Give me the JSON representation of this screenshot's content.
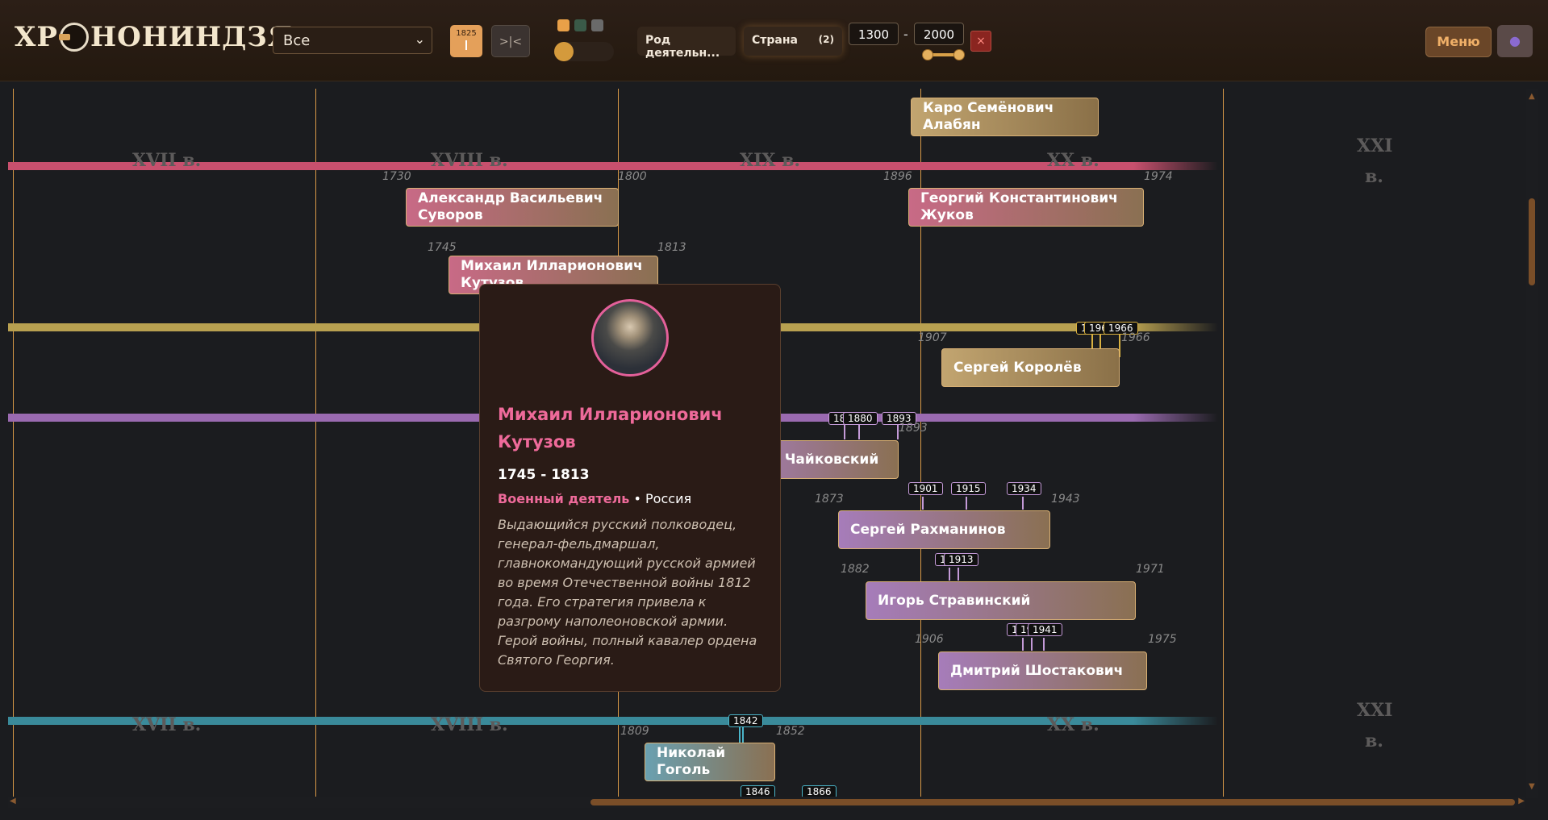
{
  "header": {
    "logo_text_before": "ХР",
    "logo_text_after": "НОНИНДЗЯ",
    "category_select": "Все",
    "year_button_value": "1825",
    "compare_button_label": ">|<",
    "filter_activity": "Род деятельн...",
    "filter_country": "Страна",
    "filter_country_count": "(2)",
    "year_from": "1300",
    "year_to": "2000",
    "range_separator": "-",
    "clear_label": "×",
    "menu_label": "Меню",
    "theme_colors": [
      "#e8a048",
      "#3a5a48",
      "#6a6a6a"
    ]
  },
  "centuries": {
    "c17": "XVII в.",
    "c18": "XVIII в.",
    "c19": "XIX в.",
    "c20": "XX в.",
    "c21a": "XXI",
    "c21b": "в."
  },
  "persons": {
    "alabyan": {
      "name": "Каро Семёнович Алабян"
    },
    "suvorov": {
      "name": "Александр Васильевич Суворов",
      "born": "1730",
      "died": "1800"
    },
    "zhukov": {
      "name": "Георгий Константинович Жуков",
      "born": "1896",
      "died": "1974"
    },
    "kutuzov": {
      "name": "Михаил Илларионович Кутузов",
      "born": "1745",
      "died": "1813"
    },
    "korolev": {
      "name": "Сергей Королёв",
      "born": "1907",
      "died": "1966"
    },
    "tchaikovsky": {
      "name": "Пётр Чайковский",
      "died": "1893"
    },
    "rachmaninov": {
      "name": "Сергей Рахманинов",
      "born": "1873",
      "died": "1943"
    },
    "stravinsky": {
      "name": "Игорь Стравинский",
      "born": "1882",
      "died": "1971"
    },
    "shostakovich": {
      "name": "Дмитрий Шостакович",
      "born": "1906",
      "died": "1975"
    },
    "gogol": {
      "name": "Николай Гоголь",
      "born": "1809",
      "died": "1852"
    }
  },
  "event_tags": {
    "korolev": [
      "1",
      "196",
      "1966"
    ],
    "tchaikovsky": [
      "18",
      "1880",
      "1893"
    ],
    "rachmaninov": [
      "1901",
      "1915",
      "1934"
    ],
    "stravinsky": [
      "1",
      "1913"
    ],
    "shostakovich": [
      "1",
      "19",
      "1941"
    ],
    "gogol": [
      "1842",
      "1846",
      "1866"
    ]
  },
  "popup": {
    "name": "Михаил Илларионович Кутузов",
    "dates": "1745 - 1813",
    "activity": "Военный деятель",
    "separator": "•",
    "country": "Россия",
    "description": "Выдающийся русский полководец, генерал-фельдмаршал, главнокомандующий русской армией во время Отечественной войны 1812 года. Его стратегия привела к разгрому наполеоновской армии. Герой войны, полный кавалер ордена Святого Георгия."
  },
  "colors": {
    "military": "#c8506e",
    "science": "#b8a050",
    "music": "#9a6ab0",
    "literature": "#3a8a9a",
    "century_line": "#d99a48",
    "accent": "#ee6a9a"
  },
  "icons": {
    "chevron": "chevron-down-icon",
    "user": "user-icon",
    "close": "close-icon"
  }
}
